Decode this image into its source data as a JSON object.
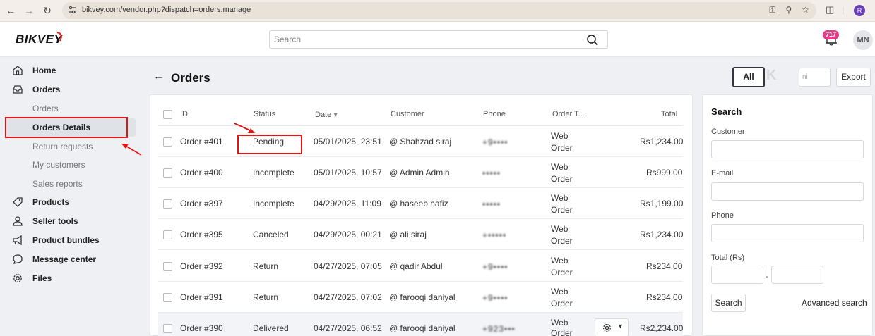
{
  "browser": {
    "url": "bikvey.com/vendor.php?dispatch=orders.manage",
    "profile_initial": "R",
    "accent_color": "#6a3fb5"
  },
  "header": {
    "logo": "BIKVEY",
    "search_placeholder": "Search",
    "notification_count": "717",
    "avatar_initials": "MN",
    "badge_color": "#e8398a"
  },
  "sidebar": {
    "items": [
      {
        "label": "Home",
        "icon": "home-icon"
      },
      {
        "label": "Orders",
        "icon": "inbox-icon"
      },
      {
        "label": "Products",
        "icon": "tag-icon"
      },
      {
        "label": "Seller tools",
        "icon": "user-icon"
      },
      {
        "label": "Product bundles",
        "icon": "megaphone-icon"
      },
      {
        "label": "Message center",
        "icon": "chat-icon"
      },
      {
        "label": "Files",
        "icon": "gear-icon"
      }
    ],
    "orders_sub": [
      {
        "label": "Orders"
      },
      {
        "label": "Orders Details",
        "active": true
      },
      {
        "label": "Return requests"
      },
      {
        "label": "My customers"
      },
      {
        "label": "Sales reports"
      }
    ]
  },
  "page": {
    "title": "Orders",
    "all_button": "All",
    "ghost_k": "K",
    "ghost_field": "ni",
    "export_button": "Export"
  },
  "table": {
    "columns": [
      "ID",
      "Status",
      "Date",
      "Customer",
      "Phone",
      "Order T...",
      "Total"
    ],
    "rows": [
      {
        "id": "Order #401",
        "status": "Pending",
        "date": "05/01/2025, 23:51",
        "customer": "@ Shahzad siraj",
        "phone": "+9••••",
        "type_line1": "Web",
        "type_line2": "Order",
        "total": "Rs1,234.00"
      },
      {
        "id": "Order #400",
        "status": "Incomplete",
        "date": "05/01/2025, 10:57",
        "customer": "@ Admin Admin",
        "phone": "•••••",
        "type_line1": "Web",
        "type_line2": "Order",
        "total": "Rs999.00"
      },
      {
        "id": "Order #397",
        "status": "Incomplete",
        "date": "04/29/2025, 11:09",
        "customer": "@ haseeb hafiz",
        "phone": "•••••",
        "type_line1": "Web",
        "type_line2": "Order",
        "total": "Rs1,199.00"
      },
      {
        "id": "Order #395",
        "status": "Canceled",
        "date": "04/29/2025, 00:21",
        "customer": "@ ali siraj",
        "phone": "+•••••",
        "type_line1": "Web",
        "type_line2": "Order",
        "total": "Rs1,234.00"
      },
      {
        "id": "Order #392",
        "status": "Return",
        "date": "04/27/2025, 07:05",
        "customer": "@ qadir Abdul",
        "phone": "+9••••",
        "type_line1": "Web",
        "type_line2": "Order",
        "total": "Rs234.00"
      },
      {
        "id": "Order #391",
        "status": "Return",
        "date": "04/27/2025, 07:02",
        "customer": "@ farooqi daniyal",
        "phone": "+9••••",
        "type_line1": "Web",
        "type_line2": "Order",
        "total": "Rs234.00"
      },
      {
        "id": "Order #390",
        "status": "Delivered",
        "date": "04/27/2025, 06:52",
        "customer": "@ farooqi daniyal",
        "phone": "+923•••",
        "type_line1": "Web",
        "type_line2": "Order",
        "total": "Rs2,234.00"
      }
    ]
  },
  "filters": {
    "title": "Search",
    "customer_label": "Customer",
    "email_label": "E-mail",
    "phone_label": "Phone",
    "total_label": "Total (Rs)",
    "range_sep": "-",
    "search_button": "Search",
    "advanced_link": "Advanced search"
  },
  "annotation_color": "#e01515"
}
